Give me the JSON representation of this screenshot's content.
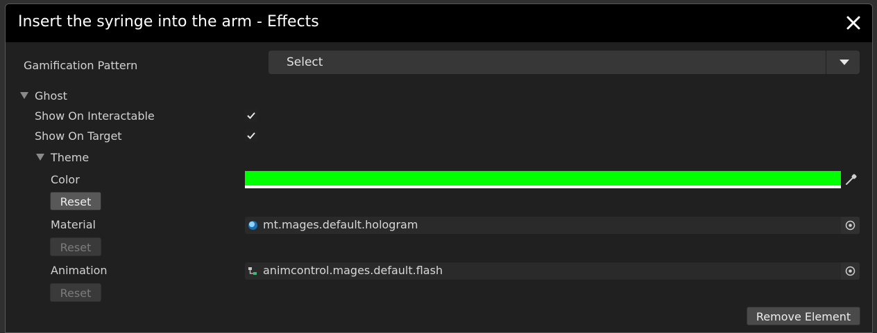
{
  "window": {
    "title": "Insert the syringe into the arm - Effects"
  },
  "gamification": {
    "label": "Gamification Pattern",
    "selected": "Select"
  },
  "ghost": {
    "label": "Ghost",
    "show_on_interactable": {
      "label": "Show On Interactable",
      "checked": true
    },
    "show_on_target": {
      "label": "Show On Target",
      "checked": true
    },
    "theme": {
      "label": "Theme",
      "color": {
        "label": "Color",
        "value": "#00ff00",
        "reset_label": "Reset"
      },
      "material": {
        "label": "Material",
        "value": "mt.mages.default.hologram",
        "reset_label": "Reset"
      },
      "animation": {
        "label": "Animation",
        "value": "animcontrol.mages.default.flash",
        "reset_label": "Reset"
      }
    }
  },
  "footer": {
    "remove_label": "Remove Element"
  },
  "icons": {
    "close": "close-icon",
    "dropdown": "chevron-down-icon",
    "foldout": "triangle-down-icon",
    "check": "check-icon",
    "eyedropper": "eyedropper-icon",
    "material": "material-sphere-icon",
    "animator": "animator-controller-icon",
    "picker": "object-picker-icon"
  }
}
